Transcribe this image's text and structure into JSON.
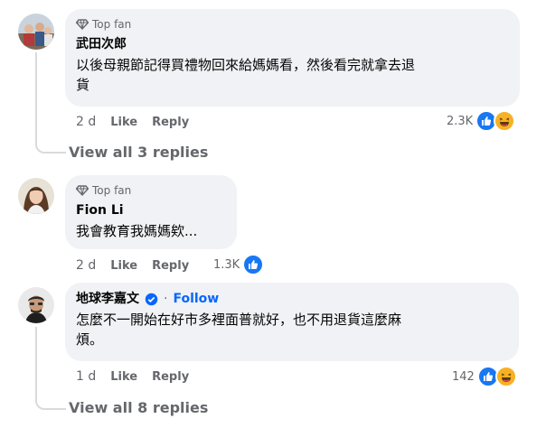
{
  "comments": [
    {
      "badge": "Top fan",
      "author": "武田次郎",
      "text_line1": "以後母親節記得買禮物回來給媽媽看，然後看完就拿去退",
      "text_line2": "貨",
      "time": "2 d",
      "like": "Like",
      "reply": "Reply",
      "reaction_count": "2.3K",
      "view_replies": "View all 3 replies"
    },
    {
      "badge": "Top fan",
      "author": "Fion Li",
      "text_line1": "我會教育我媽媽欸...",
      "time": "2 d",
      "like": "Like",
      "reply": "Reply",
      "reaction_count": "1.3K"
    },
    {
      "author": "地球李嘉文",
      "separator": "·",
      "follow": "Follow",
      "text_line1": "怎麼不一開始在好市多裡面普就好，也不用退貨這麼麻",
      "text_line2": "煩。",
      "time": "1 d",
      "like": "Like",
      "reply": "Reply",
      "reaction_count": "142",
      "view_replies": "View all 8 replies"
    }
  ],
  "colors": {
    "bubble": "#f0f2f5",
    "link": "#0866ff",
    "meta": "#65676b",
    "like_blue": "#1877f2",
    "haha_yellow": "#f7b125"
  },
  "icons": [
    "diamond-icon",
    "like-reaction-icon",
    "haha-reaction-icon",
    "verified-badge-icon"
  ]
}
